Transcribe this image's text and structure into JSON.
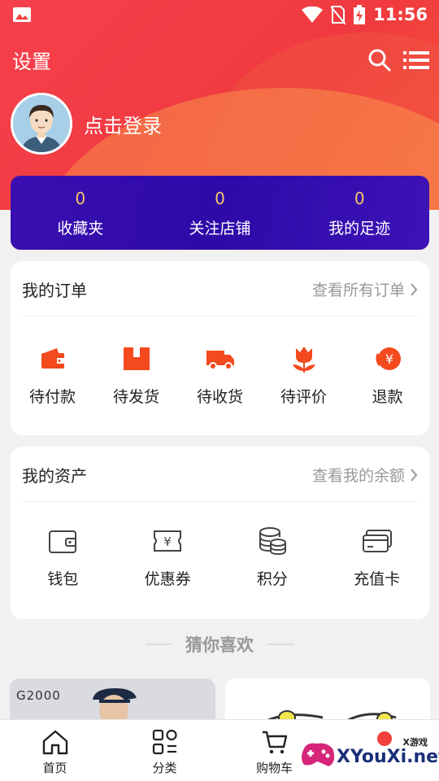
{
  "status_bar": {
    "time": "11:56"
  },
  "header": {
    "title": "设置"
  },
  "profile": {
    "login_text": "点击登录"
  },
  "stats": [
    {
      "count": "0",
      "label": "收藏夹"
    },
    {
      "count": "0",
      "label": "关注店铺"
    },
    {
      "count": "0",
      "label": "我的足迹"
    }
  ],
  "orders": {
    "title": "我的订单",
    "link": "查看所有订单",
    "items": [
      {
        "label": "待付款",
        "icon": "wallet-icon"
      },
      {
        "label": "待发货",
        "icon": "package-icon"
      },
      {
        "label": "待收货",
        "icon": "truck-icon"
      },
      {
        "label": "待评价",
        "icon": "tulip-icon"
      },
      {
        "label": "退款",
        "icon": "refund-yen-icon"
      }
    ]
  },
  "assets": {
    "title": "我的资产",
    "link": "查看我的余额",
    "items": [
      {
        "label": "钱包",
        "icon": "wallet-outline-icon"
      },
      {
        "label": "优惠券",
        "icon": "coupon-icon"
      },
      {
        "label": "积分",
        "icon": "coins-icon"
      },
      {
        "label": "充值卡",
        "icon": "card-icon"
      }
    ]
  },
  "recommend": {
    "title": "猜你喜欢",
    "product1_brand": "G2000"
  },
  "tabbar": [
    {
      "label": "首页",
      "icon": "home-icon"
    },
    {
      "label": "分类",
      "icon": "category-icon"
    },
    {
      "label": "购物车",
      "icon": "cart-icon"
    },
    {
      "label": "",
      "icon": "user-icon"
    }
  ],
  "watermark": {
    "small": "X游戏",
    "big": "XYouXi.net"
  },
  "colors": {
    "accent": "#f2403d",
    "stats_bg": "#3a0fb0",
    "icon_orange": "#f34a1e"
  }
}
